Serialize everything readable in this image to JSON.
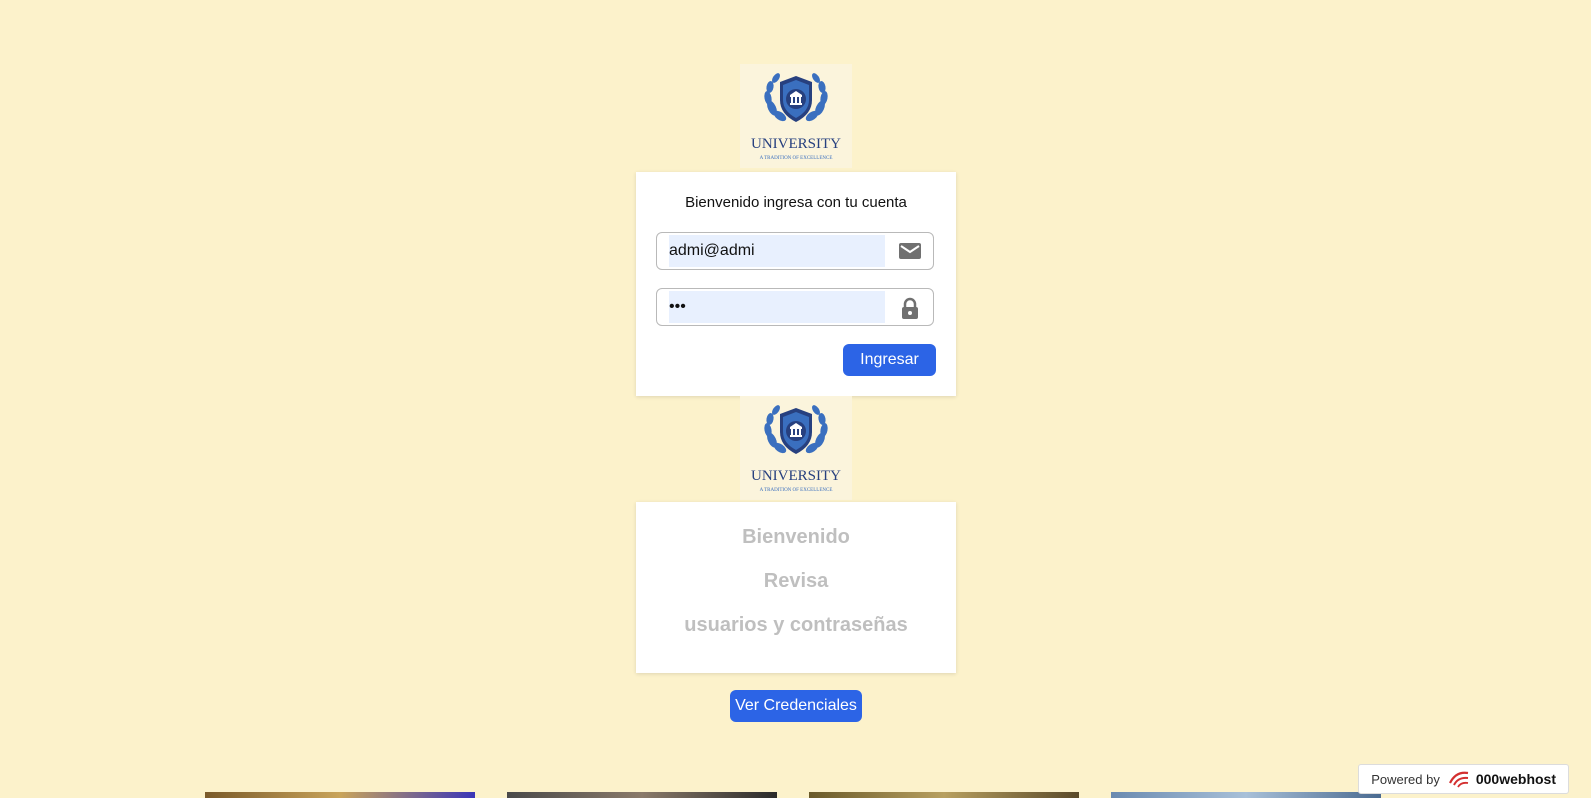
{
  "logo": {
    "wordmark": "UNIVERSITY",
    "tagline": "A TRADITION OF EXCELLENCE"
  },
  "login": {
    "title": "Bienvenido ingresa con tu cuenta",
    "email_value": "admi@admi",
    "password_value": "•••",
    "submit_label": "Ingresar",
    "email_icon": "mail-icon",
    "password_icon": "lock-icon"
  },
  "info": {
    "line1": "Bienvenido",
    "line2": "Revisa",
    "line3": "usuarios y contraseñas"
  },
  "credentials_button": "Ver Credenciales",
  "footer": {
    "powered_by": "Powered by",
    "brand": "000webhost"
  },
  "colors": {
    "background": "#fcf2cb",
    "primary_button": "#2c64e6",
    "input_autofill": "#e8f0fe",
    "info_text": "#bfbfbf"
  }
}
